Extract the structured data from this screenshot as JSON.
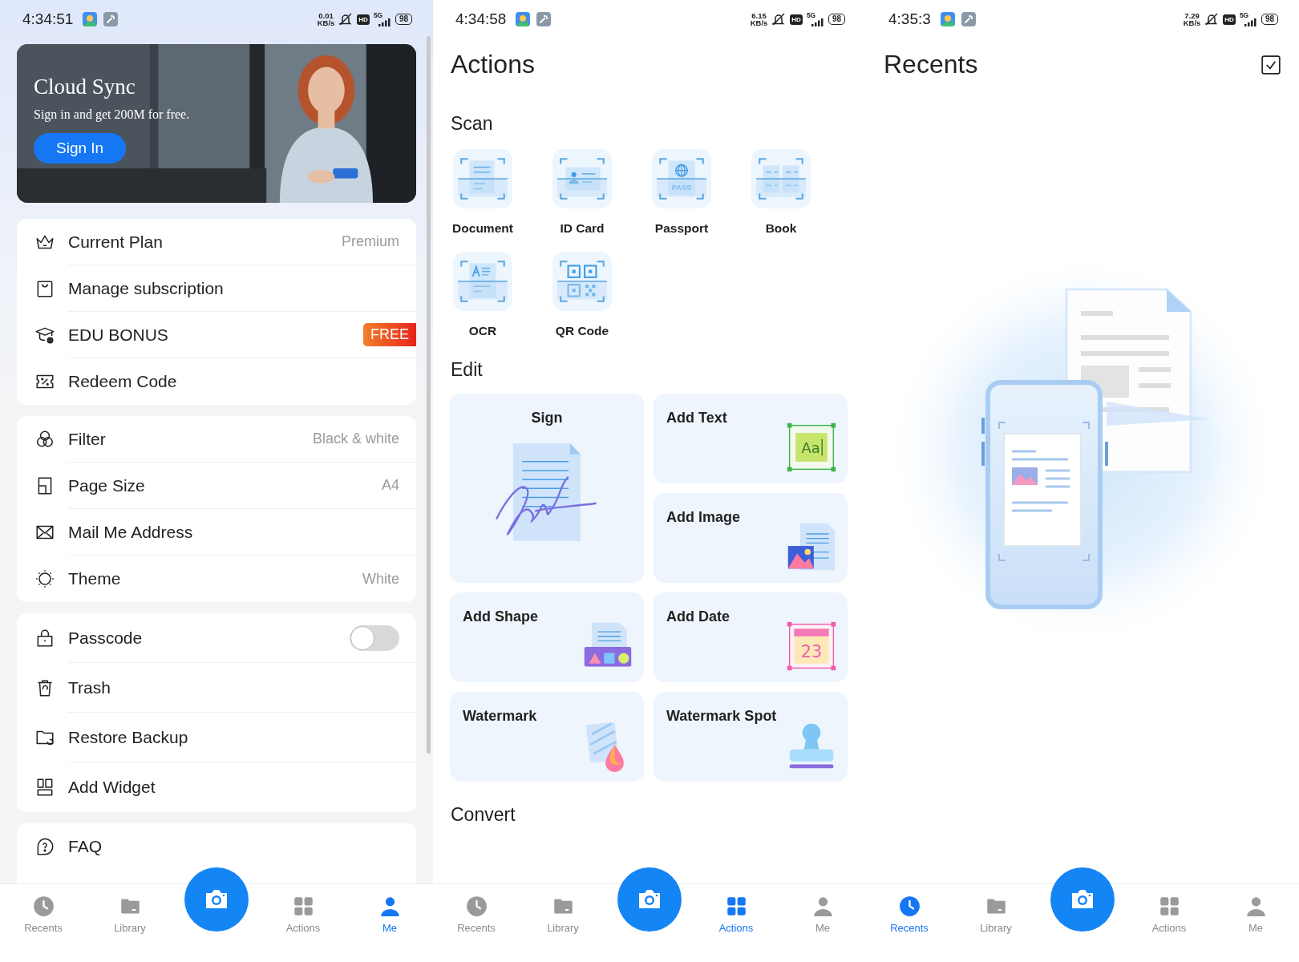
{
  "screens": [
    {
      "kind": "me",
      "status": {
        "time": "4:34:51",
        "speed": "0.01",
        "speed_unit": "KB/s",
        "hd": "HD",
        "network": "5G",
        "battery": "98"
      },
      "banner": {
        "title": "Cloud Sync",
        "subtitle": "Sign in and get 200M for free.",
        "button": "Sign In"
      },
      "groups": [
        {
          "rows": [
            {
              "kind": "value",
              "label": "Current Plan",
              "value": "Premium"
            },
            {
              "kind": "plain",
              "label": "Manage subscription"
            },
            {
              "kind": "badge",
              "label": "EDU BONUS",
              "badge": "FREE"
            },
            {
              "kind": "plain",
              "label": "Redeem Code"
            }
          ]
        },
        {
          "rows": [
            {
              "kind": "value",
              "label": "Filter",
              "value": "Black & white"
            },
            {
              "kind": "value",
              "label": "Page Size",
              "value": "A4"
            },
            {
              "kind": "plain",
              "label": "Mail Me Address"
            },
            {
              "kind": "value",
              "label": "Theme",
              "value": "White"
            }
          ]
        },
        {
          "rows": [
            {
              "kind": "toggle",
              "label": "Passcode",
              "on": false
            },
            {
              "kind": "plain",
              "label": "Trash"
            },
            {
              "kind": "plain",
              "label": "Restore Backup"
            },
            {
              "kind": "plain",
              "label": "Add Widget"
            }
          ]
        },
        {
          "rows": [
            {
              "kind": "plain",
              "label": "FAQ"
            }
          ]
        }
      ],
      "nav": [
        {
          "label": "Recents",
          "selected": false
        },
        {
          "label": "Library",
          "selected": false
        },
        {
          "label": "Actions",
          "selected": false
        },
        {
          "label": "Me",
          "selected": true
        }
      ]
    },
    {
      "kind": "actions",
      "status": {
        "time": "4:34:58",
        "speed": "6.15",
        "speed_unit": "KB/s",
        "hd": "HD",
        "network": "5G",
        "battery": "98"
      },
      "title": "Actions",
      "scan": {
        "heading": "Scan",
        "items": [
          {
            "label": "Document"
          },
          {
            "label": "ID Card"
          },
          {
            "label": "Passport",
            "tile_text": "PASS"
          },
          {
            "label": "Book"
          },
          {
            "label": "OCR"
          },
          {
            "label": "QR Code"
          }
        ]
      },
      "edit": {
        "heading": "Edit",
        "cards": [
          {
            "label": "Sign"
          },
          {
            "label": "Add Text",
            "art_text": "Aa"
          },
          {
            "label": "Add Image"
          },
          {
            "label": "Add Shape"
          },
          {
            "label": "Add Date",
            "art_text": "23"
          },
          {
            "label": "Watermark"
          },
          {
            "label": "Watermark Spot"
          }
        ]
      },
      "convert": {
        "heading": "Convert"
      },
      "nav": [
        {
          "label": "Recents",
          "selected": false
        },
        {
          "label": "Library",
          "selected": false
        },
        {
          "label": "Actions",
          "selected": true
        },
        {
          "label": "Me",
          "selected": false
        }
      ]
    },
    {
      "kind": "recents",
      "status": {
        "time": "4:35:3",
        "speed": "7.29",
        "speed_unit": "KB/s",
        "hd": "HD",
        "network": "5G",
        "battery": "98"
      },
      "title": "Recents",
      "nav": [
        {
          "label": "Recents",
          "selected": true
        },
        {
          "label": "Library",
          "selected": false
        },
        {
          "label": "Actions",
          "selected": false
        },
        {
          "label": "Me",
          "selected": false
        }
      ]
    }
  ]
}
